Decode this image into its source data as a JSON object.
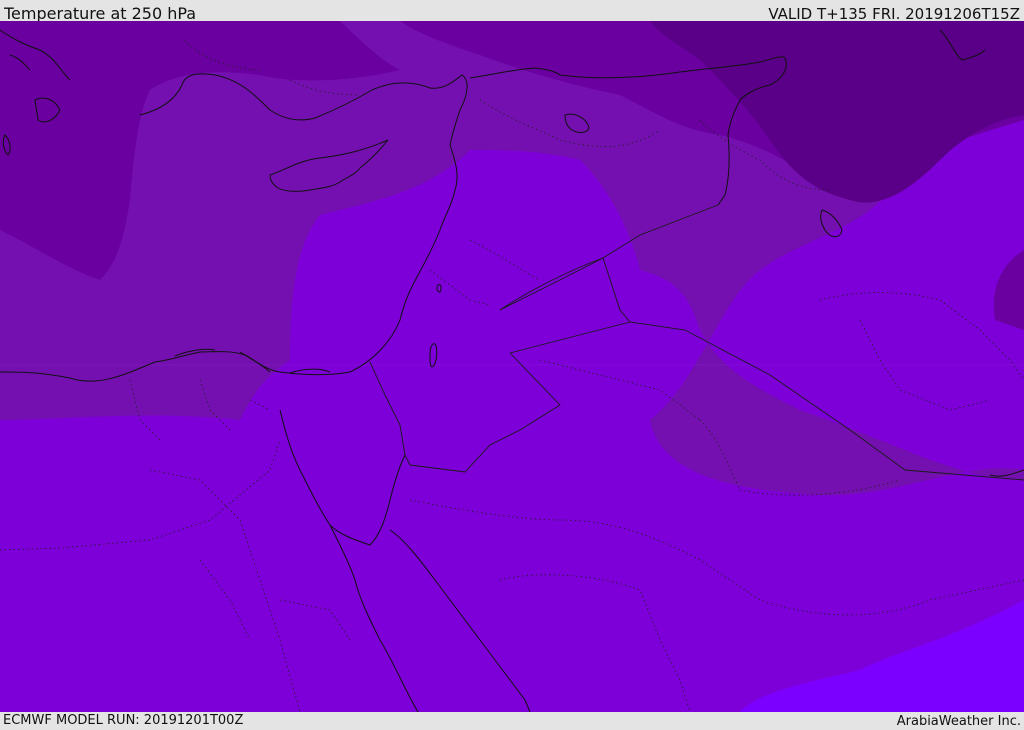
{
  "header": {
    "title": "Temperature at 250 hPa",
    "valid": "VALID T+135 FRI. 20191206T15Z"
  },
  "footer": {
    "model_run": "ECMWF MODEL RUN: 20191201T00Z",
    "credit": "ArabiaWeather Inc."
  },
  "map": {
    "region": "Eastern Mediterranean and Middle East",
    "colors": {
      "darkest": "#5a0088",
      "dark": "#6a00a0",
      "mid": "#7510b0",
      "light": "#7e00d8",
      "lightest": "#7b00ff",
      "coastline": "#111111",
      "border": "#1a1a1a"
    }
  }
}
